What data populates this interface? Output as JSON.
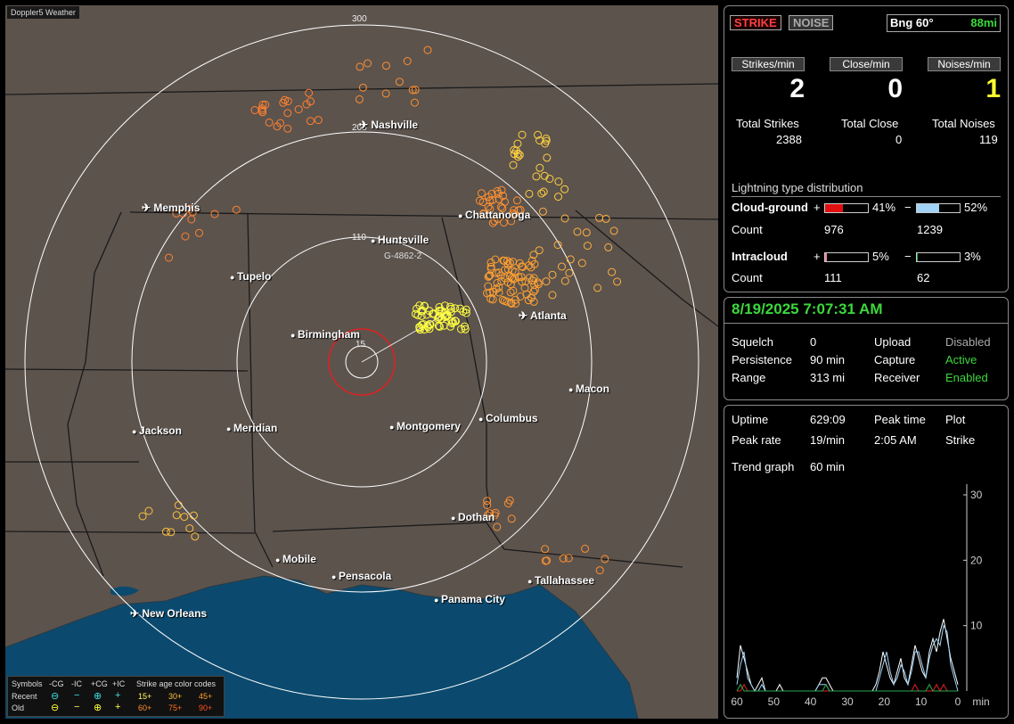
{
  "app_title": "Doppler5 Weather",
  "map": {
    "cities": [
      {
        "name": "Nashville",
        "icon": "airport-icon"
      },
      {
        "name": "Memphis",
        "icon": "airport-icon"
      },
      {
        "name": "Chattanooga",
        "icon": "city-dot-icon"
      },
      {
        "name": "Huntsville",
        "icon": "city-dot-icon"
      },
      {
        "name": "Tupelo",
        "icon": "city-dot-icon"
      },
      {
        "name": "Atlanta",
        "icon": "airport-icon"
      },
      {
        "name": "Birmingham",
        "icon": "city-dot-icon"
      },
      {
        "name": "Macon",
        "icon": "city-dot-icon"
      },
      {
        "name": "Jackson",
        "icon": "city-dot-icon"
      },
      {
        "name": "Meridian",
        "icon": "city-dot-icon"
      },
      {
        "name": "Montgomery",
        "icon": "city-dot-icon"
      },
      {
        "name": "Columbus",
        "icon": "city-dot-icon"
      },
      {
        "name": "Dothan",
        "icon": "city-dot-icon"
      },
      {
        "name": "Mobile",
        "icon": "city-dot-icon"
      },
      {
        "name": "Pensacola",
        "icon": "city-dot-icon"
      },
      {
        "name": "Tallahassee",
        "icon": "city-dot-icon"
      },
      {
        "name": "Panama City",
        "icon": "city-dot-icon"
      },
      {
        "name": "New Orleans",
        "icon": "airport-icon"
      }
    ],
    "ring_labels": [
      "300",
      "205",
      "110",
      "15"
    ],
    "cell_label": "G-4862-2",
    "colors": {
      "land": "#5c534d",
      "water": "#0b4a6e",
      "rings": "#ffffff",
      "close_ring": "#e02020"
    }
  },
  "legend": {
    "symbols": "Symbols",
    "cols": [
      "-CG",
      "-IC",
      "+CG",
      "+IC"
    ],
    "recent": "Recent",
    "old": "Old",
    "age_title": "Strike age color codes",
    "recent_ages": [
      "15+",
      "30+",
      "45+"
    ],
    "old_ages": [
      "60+",
      "75+",
      "90+"
    ]
  },
  "status": {
    "strike_btn": "STRIKE",
    "noise_btn": "NOISE",
    "bearing": "Bng 60°",
    "distance": "88mi",
    "rate_headers": [
      "Strikes/min",
      "Close/min",
      "Noises/min"
    ],
    "rates": [
      "2",
      "0",
      "1"
    ],
    "total_labels": [
      "Total Strikes",
      "Total Close",
      "Total Noises"
    ],
    "totals": [
      "2388",
      "0",
      "119"
    ]
  },
  "distribution": {
    "title": "Lightning type distribution",
    "cg_label": "Cloud-ground",
    "ic_label": "Intracloud",
    "count_label": "Count",
    "plus": "+",
    "minus": "−",
    "cg_pos_pct": "41%",
    "cg_neg_pct": "52%",
    "cg_pos_count": "976",
    "cg_neg_count": "1239",
    "ic_pos_pct": "5%",
    "ic_neg_pct": "3%",
    "ic_pos_count": "111",
    "ic_neg_count": "62",
    "fills": {
      "cg_pos": 0.41,
      "cg_neg": 0.52,
      "ic_pos": 0.05,
      "ic_neg": 0.03
    },
    "colors": {
      "cg_pos": "#e01010",
      "cg_neg": "#9fd3f7",
      "ic_pos": "#f080b0",
      "ic_neg": "#2aa84a"
    }
  },
  "datetime": "8/19/2025 7:07:31 AM",
  "settings": {
    "squelch_label": "Squelch",
    "squelch": "0",
    "persistence_label": "Persistence",
    "persistence": "90 min",
    "range_label": "Range",
    "range": "313 mi",
    "upload_label": "Upload",
    "upload": "Disabled",
    "capture_label": "Capture",
    "capture": "Active",
    "receiver_label": "Receiver",
    "receiver": "Enabled"
  },
  "stats": {
    "uptime_label": "Uptime",
    "uptime": "629:09",
    "peak_time_label": "Peak time",
    "plot_label": "Plot",
    "peak_rate_label": "Peak rate",
    "peak_rate": "19/min",
    "peak_time": "2:05 AM",
    "plot": "Strike",
    "trend_label": "Trend graph",
    "trend": "60 min"
  },
  "chart_data": {
    "type": "line",
    "xlabel": "min",
    "x_ticks": [
      "60",
      "50",
      "40",
      "30",
      "20",
      "10",
      "0"
    ],
    "y_ticks": [
      "30",
      "20",
      "10"
    ],
    "ylim": [
      0,
      30
    ],
    "xlim": [
      60,
      0
    ],
    "series": [
      {
        "color": "#ffffff",
        "values": [
          2,
          7,
          5,
          3,
          1,
          0,
          1,
          2,
          0,
          0,
          0,
          0,
          1,
          0,
          0,
          0,
          0,
          0,
          0,
          0,
          0,
          0,
          0,
          1,
          2,
          2,
          1,
          0,
          0,
          0,
          0,
          0,
          0,
          0,
          0,
          0,
          0,
          0,
          0,
          1,
          3,
          6,
          4,
          2,
          1,
          3,
          5,
          2,
          1,
          4,
          7,
          5,
          3,
          2,
          6,
          8,
          6,
          9,
          11,
          8,
          5,
          3,
          1
        ]
      },
      {
        "color": "#9fd3f7",
        "values": [
          1,
          4,
          6,
          2,
          1,
          0,
          0,
          1,
          0,
          0,
          0,
          0,
          0,
          0,
          0,
          0,
          0,
          0,
          0,
          0,
          0,
          0,
          0,
          1,
          1,
          1,
          0,
          0,
          0,
          0,
          0,
          0,
          0,
          0,
          0,
          0,
          0,
          0,
          0,
          0,
          2,
          4,
          6,
          3,
          1,
          2,
          4,
          3,
          1,
          3,
          6,
          6,
          4,
          2,
          5,
          7,
          8,
          7,
          10,
          9,
          4,
          2,
          0
        ]
      },
      {
        "color": "#e02020",
        "values": [
          0,
          0,
          1,
          0,
          0,
          0,
          0,
          0,
          0,
          0,
          0,
          0,
          0,
          0,
          0,
          0,
          0,
          0,
          0,
          0,
          0,
          0,
          0,
          0,
          0,
          0,
          0,
          0,
          0,
          0,
          0,
          0,
          0,
          0,
          0,
          0,
          0,
          0,
          0,
          0,
          0,
          0,
          0,
          0,
          0,
          0,
          0,
          0,
          0,
          0,
          1,
          0,
          0,
          0,
          0,
          0,
          1,
          0,
          1,
          0,
          0,
          0,
          0
        ]
      },
      {
        "color": "#2aa84a",
        "values": [
          0,
          1,
          0,
          0,
          0,
          0,
          0,
          0,
          0,
          0,
          0,
          0,
          0,
          0,
          0,
          0,
          0,
          0,
          0,
          0,
          0,
          0,
          0,
          0,
          0,
          1,
          0,
          0,
          0,
          0,
          0,
          0,
          0,
          0,
          0,
          0,
          0,
          0,
          0,
          0,
          0,
          0,
          0,
          0,
          0,
          0,
          0,
          0,
          0,
          0,
          0,
          0,
          0,
          0,
          1,
          0,
          0,
          0,
          0,
          0,
          0,
          0,
          0
        ]
      }
    ]
  }
}
